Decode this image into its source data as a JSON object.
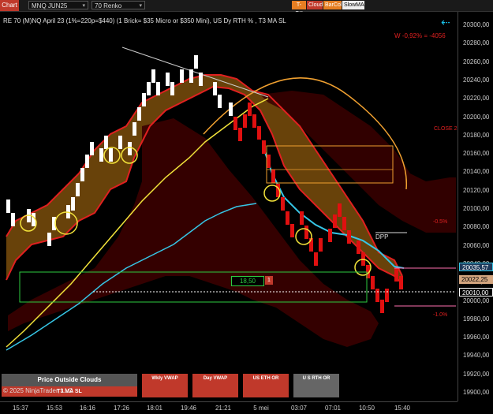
{
  "toolbar": {
    "chart_tab": "Chart",
    "instrument": "MNQ JUN25",
    "bar_type": "70 Renko",
    "buttons": [
      {
        "label": "T-OK",
        "color": "#e67e22"
      },
      {
        "label": "Cloud",
        "color": "#c0392b"
      },
      {
        "label": "BarCol",
        "color": "#e67e22"
      },
      {
        "label": "SlowMA",
        "color": "#eeeeee"
      }
    ]
  },
  "chart": {
    "title": "RE 70 (M)NQ April 23 (1%=220p=$440) (1 Brick= $35 Micro or $350 Mini), US Dy RTH % , T3 MA SL",
    "status_text": "W -0,92% = -4056",
    "close_label": "CLOSE 2",
    "pct_label_upper": "-0.5%",
    "pct_label_lower": "-1.0%",
    "dpp_label": "DPP",
    "box_value": "18,50",
    "box_count": "1",
    "copyright": "© 2025 NinjaTrader, LLC",
    "colors": {
      "bull_brick": "#ffffff",
      "bear_brick": "#e01010",
      "cloud_bull": "#8a5a10",
      "cloud_bear": "#5a0000",
      "fast_ma": "#36c6e6",
      "slow_ma": "#f2e23a",
      "arc": "#f0a030"
    }
  },
  "price_axis": {
    "ticks": [
      "20300,00",
      "20280,00",
      "20260,00",
      "20240,00",
      "20220,00",
      "20200,00",
      "20180,00",
      "20160,00",
      "20140,00",
      "20120,00",
      "20100,00",
      "20080,00",
      "20060,00",
      "20040,00",
      "20020,00",
      "20000,00",
      "19980,00",
      "19960,00",
      "19940,00",
      "19920,00",
      "19900,00"
    ],
    "badge_upper": "20035,57",
    "badge_mid": "20022,25",
    "badge_lower": "20010,00"
  },
  "time_axis": {
    "labels": [
      "15:37",
      "15:53",
      "16:16",
      "17:26",
      "18:01",
      "19:46",
      "21:21",
      "5 mei",
      "03:07",
      "07:01",
      "10:50",
      "15:40"
    ]
  },
  "panels": [
    {
      "line1": "Price Outside Clouds",
      "line2": "T3 MA SL"
    },
    {
      "line1": "Wkly VWAP"
    },
    {
      "line1": "Day VWAP"
    },
    {
      "line1": "US ETH OR"
    },
    {
      "line1": "U S RTH OR"
    }
  ]
}
